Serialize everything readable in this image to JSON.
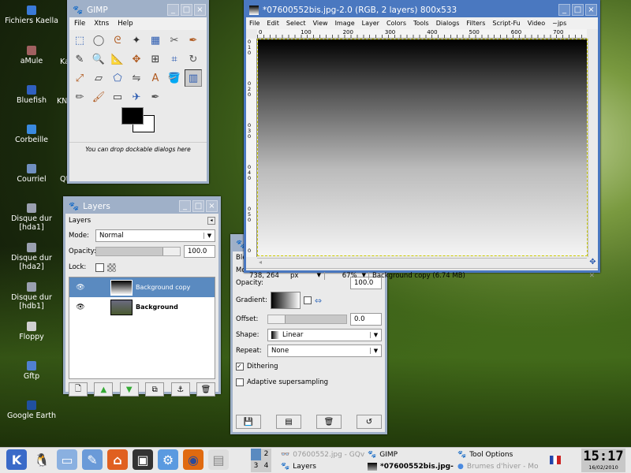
{
  "desktop": {
    "icons": [
      {
        "label": "Fichiers Kaella",
        "color": "#3a7ad8"
      },
      {
        "label": "aMule",
        "color": "#a06060"
      },
      {
        "label": "Bluefish",
        "color": "#3060c0"
      },
      {
        "label": "Corbeille",
        "color": "#3a8ae0"
      },
      {
        "label": "Courriel",
        "color": "#7090c0"
      },
      {
        "label": "Disque dur [hda1]",
        "color": "#9aa0b0"
      },
      {
        "label": "Disque dur [hda2]",
        "color": "#9aa0b0"
      },
      {
        "label": "Disque dur [hdb1]",
        "color": "#9aa0b0"
      },
      {
        "label": "Floppy",
        "color": "#d0d0d0"
      },
      {
        "label": "Gftp",
        "color": "#5080d0"
      },
      {
        "label": "Google Earth",
        "color": "#2050a0"
      }
    ],
    "partial_labels": [
      "Ka",
      "KN",
      "Qt",
      "X",
      "m"
    ]
  },
  "toolbox": {
    "title": "GIMP",
    "menu": [
      "File",
      "Xtns",
      "Help"
    ],
    "hint": "You can drop dockable dialogs here",
    "tools": [
      "rect-select",
      "ellipse-select",
      "lasso",
      "fuzzy-select",
      "select-by-color",
      "scissors",
      "paths",
      "color-picker",
      "zoom",
      "measure",
      "move",
      "align",
      "crop",
      "rotate",
      "scale",
      "shear",
      "perspective",
      "flip",
      "text",
      "bucket-fill",
      "blend",
      "pencil",
      "paintbrush",
      "eraser",
      "airbrush",
      "ink",
      "clone",
      "heal",
      "perspective-clone",
      "convolve",
      "smudge",
      "dodge-burn"
    ],
    "fg_color": "#000000",
    "bg_color": "#ffffff"
  },
  "layers": {
    "title": "Layers",
    "tab": "Layers",
    "mode_label": "Mode:",
    "mode": "Normal",
    "opacity_label": "Opacity:",
    "opacity": "100.0",
    "lock_label": "Lock:",
    "items": [
      {
        "name": "Background copy",
        "selected": true,
        "visible": true
      },
      {
        "name": "Background",
        "selected": false,
        "visible": true
      }
    ]
  },
  "tool_options": {
    "title_partial": "Ble",
    "mode_partial": "Mo",
    "opacity_label": "Opacity:",
    "opacity": "100.0",
    "gradient_label": "Gradient:",
    "offset_label": "Offset:",
    "offset": "0.0",
    "shape_label": "Shape:",
    "shape": "Linear",
    "repeat_label": "Repeat:",
    "repeat": "None",
    "dithering": "Dithering",
    "dithering_checked": true,
    "adaptive": "Adaptive supersampling",
    "adaptive_checked": false
  },
  "image_window": {
    "title": "*07600552bis.jpg-2.0 (RGB, 2 layers) 800x533",
    "menu": [
      "File",
      "Edit",
      "Select",
      "View",
      "Image",
      "Layer",
      "Colors",
      "Tools",
      "Dialogs",
      "Filters",
      "Script-Fu",
      "Video",
      "~jps"
    ],
    "ruler_h": [
      "0",
      "100",
      "200",
      "300",
      "400",
      "500",
      "600",
      "700"
    ],
    "ruler_v": [
      "0",
      "1",
      "0",
      "0",
      "2",
      "0",
      "0",
      "3",
      "0",
      "0",
      "4",
      "0",
      "0",
      "5",
      "0",
      "0"
    ],
    "coords": "738, 264",
    "unit": "px",
    "zoom": "67%",
    "status": "Background copy (6.74 MB)"
  },
  "taskbar": {
    "desktops": [
      "1",
      "2",
      "3",
      "4"
    ],
    "tasks": [
      {
        "label": "07600552.jpg - GQv",
        "active": false
      },
      {
        "label": "GIMP",
        "active": false
      },
      {
        "label": "Tool Options",
        "active": false
      },
      {
        "label": "Layers",
        "active": false
      },
      {
        "label": "*07600552bis.jpg-",
        "active": true
      },
      {
        "label": "Brumes d'hiver - Mo",
        "active": false
      }
    ],
    "launchers": [
      "kde-menu",
      "tux",
      "windows",
      "kate",
      "home",
      "terminal",
      "konqueror",
      "firefox",
      "document"
    ],
    "time": "15:17",
    "date": "16/02/2010"
  }
}
